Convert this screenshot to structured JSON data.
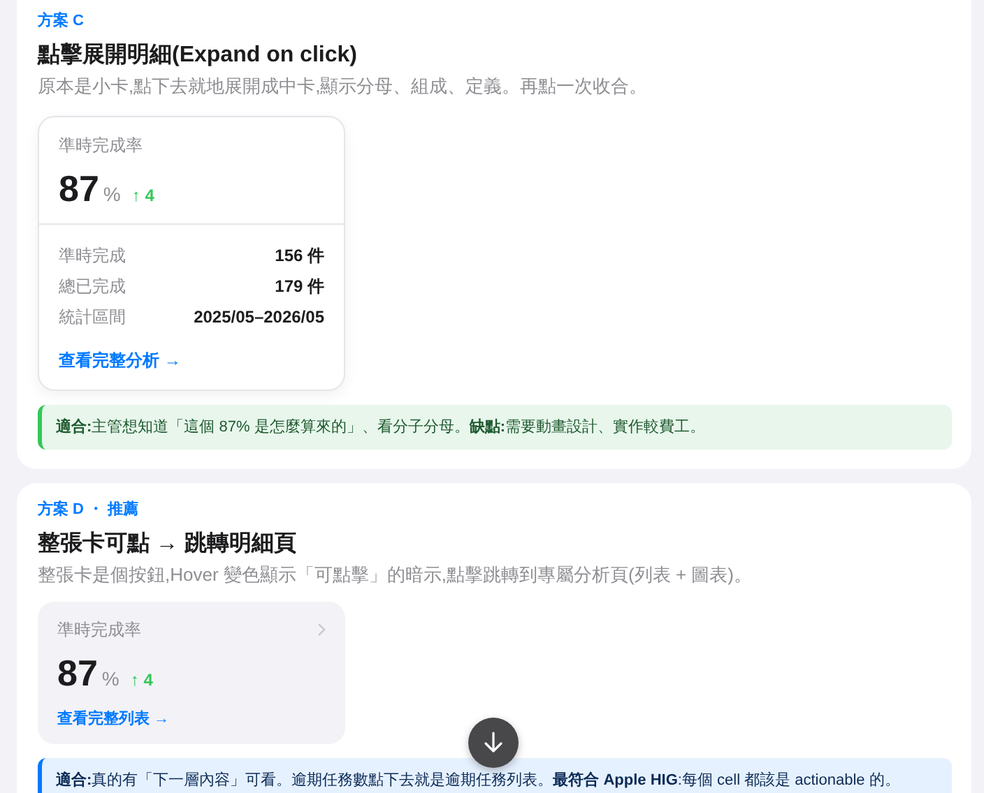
{
  "sections": [
    {
      "label": "方案 C",
      "title": "點擊展開明細(Expand on click)",
      "description": "原本是小卡,點下去就地展開成中卡,顯示分母、組成、定義。再點一次收合。",
      "card": {
        "kind": "expanded",
        "metric": "準時完成率",
        "value": "87",
        "unit": "%",
        "delta": "↑ 4",
        "rows": [
          {
            "label": "準時完成",
            "value": "156 件"
          },
          {
            "label": "總已完成",
            "value": "179 件"
          },
          {
            "label": "統計區間",
            "value": "2025/05–2026/05"
          }
        ],
        "link": "查看完整分析 →"
      },
      "note": {
        "kind": "good",
        "text": "**適合:**主管想知道「這個 87% 是怎麼算來的」、看分子分母。**缺點:**需要動畫設計、實作較費工。"
      }
    },
    {
      "label": "方案 D ・ 推薦",
      "title": "整張卡可點 → 跳轉明細頁",
      "description": "整張卡是個按鈕,Hover 變色顯示「可點擊」的暗示,點擊跳轉到專屬分析頁(列表 + 圖表)。",
      "card": {
        "kind": "tappable",
        "metric": "準時完成率",
        "value": "87",
        "unit": "%",
        "delta": "↑ 4",
        "link": "查看完整列表 →"
      },
      "note": {
        "kind": "info",
        "text": "**適合:**真的有「下一層內容」可看。逾期任務數點下去就是逾期任務列表。**最符合 Apple HIG**:每個 cell 都該是 actionable 的。"
      }
    }
  ]
}
